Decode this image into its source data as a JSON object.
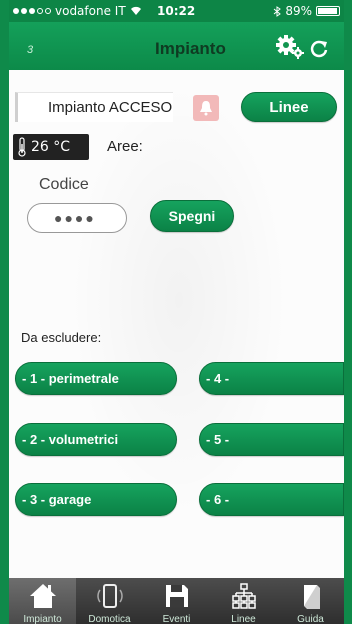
{
  "statusbar": {
    "carrier": "vodafone IT",
    "time": "10:22",
    "battery": "89%"
  },
  "header": {
    "number": "3",
    "title": "Impianto"
  },
  "status": {
    "text": "Impianto ACCESO"
  },
  "buttons": {
    "linee": "Linee",
    "spegni": "Spegni"
  },
  "temperature": "26 °C",
  "aree_label": "Aree:",
  "codice": {
    "label": "Codice",
    "value": "●●●●"
  },
  "exclude_label": "Da escludere:",
  "zones": [
    "- 1 - perimetrale",
    "- 2 - volumetrici",
    "- 3 - garage",
    "- 4 -",
    "- 5 -",
    "- 6 -"
  ],
  "tabs": [
    "Impianto",
    "Domotica",
    "Eventi",
    "Linee",
    "Guida"
  ]
}
